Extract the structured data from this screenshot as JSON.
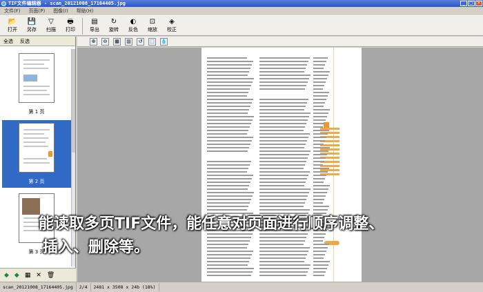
{
  "window": {
    "title": "TIF文件编辑器 - scan_20121008_17164405.jpg"
  },
  "menu": [
    "文件(F)",
    "页面(P)",
    "图像(I)",
    "帮助(H)"
  ],
  "toolbar": [
    {
      "label": "打开",
      "icon": "📂",
      "name": "open"
    },
    {
      "label": "另存",
      "icon": "💾",
      "name": "save-as"
    },
    {
      "label": "扫描",
      "icon": "▽",
      "name": "scan"
    },
    {
      "label": "打印",
      "icon": "🖶",
      "name": "print"
    },
    {
      "label": "导出",
      "icon": "▤",
      "name": "export"
    },
    {
      "label": "旋转",
      "icon": "↻",
      "name": "rotate"
    },
    {
      "label": "反色",
      "icon": "◐",
      "name": "invert"
    },
    {
      "label": "缩放",
      "icon": "⊡",
      "name": "zoom"
    },
    {
      "label": "校正",
      "icon": "◈",
      "name": "correct"
    }
  ],
  "left_panel": {
    "select_all": "全选",
    "invert_select": "反选",
    "thumbnails": [
      {
        "label": "第 1 页",
        "selected": false
      },
      {
        "label": "第 2 页",
        "selected": true
      },
      {
        "label": "第 3 页",
        "selected": false
      }
    ],
    "tools": [
      "◆",
      "◆",
      "▦",
      "✕",
      "🗑"
    ]
  },
  "viewer_tools": [
    "⊕",
    "⊖",
    "▦",
    "▥",
    "↺",
    "⬚",
    "💧"
  ],
  "caption": {
    "line1": "能读取多页TIF文件，能任意对页面进行顺序调整、",
    "line2": "插入、删除等。"
  },
  "status": {
    "file": "scan_20121008_17164405.jpg",
    "page": "2/4",
    "info": "2481 x 3508 x 24b (18%)"
  }
}
